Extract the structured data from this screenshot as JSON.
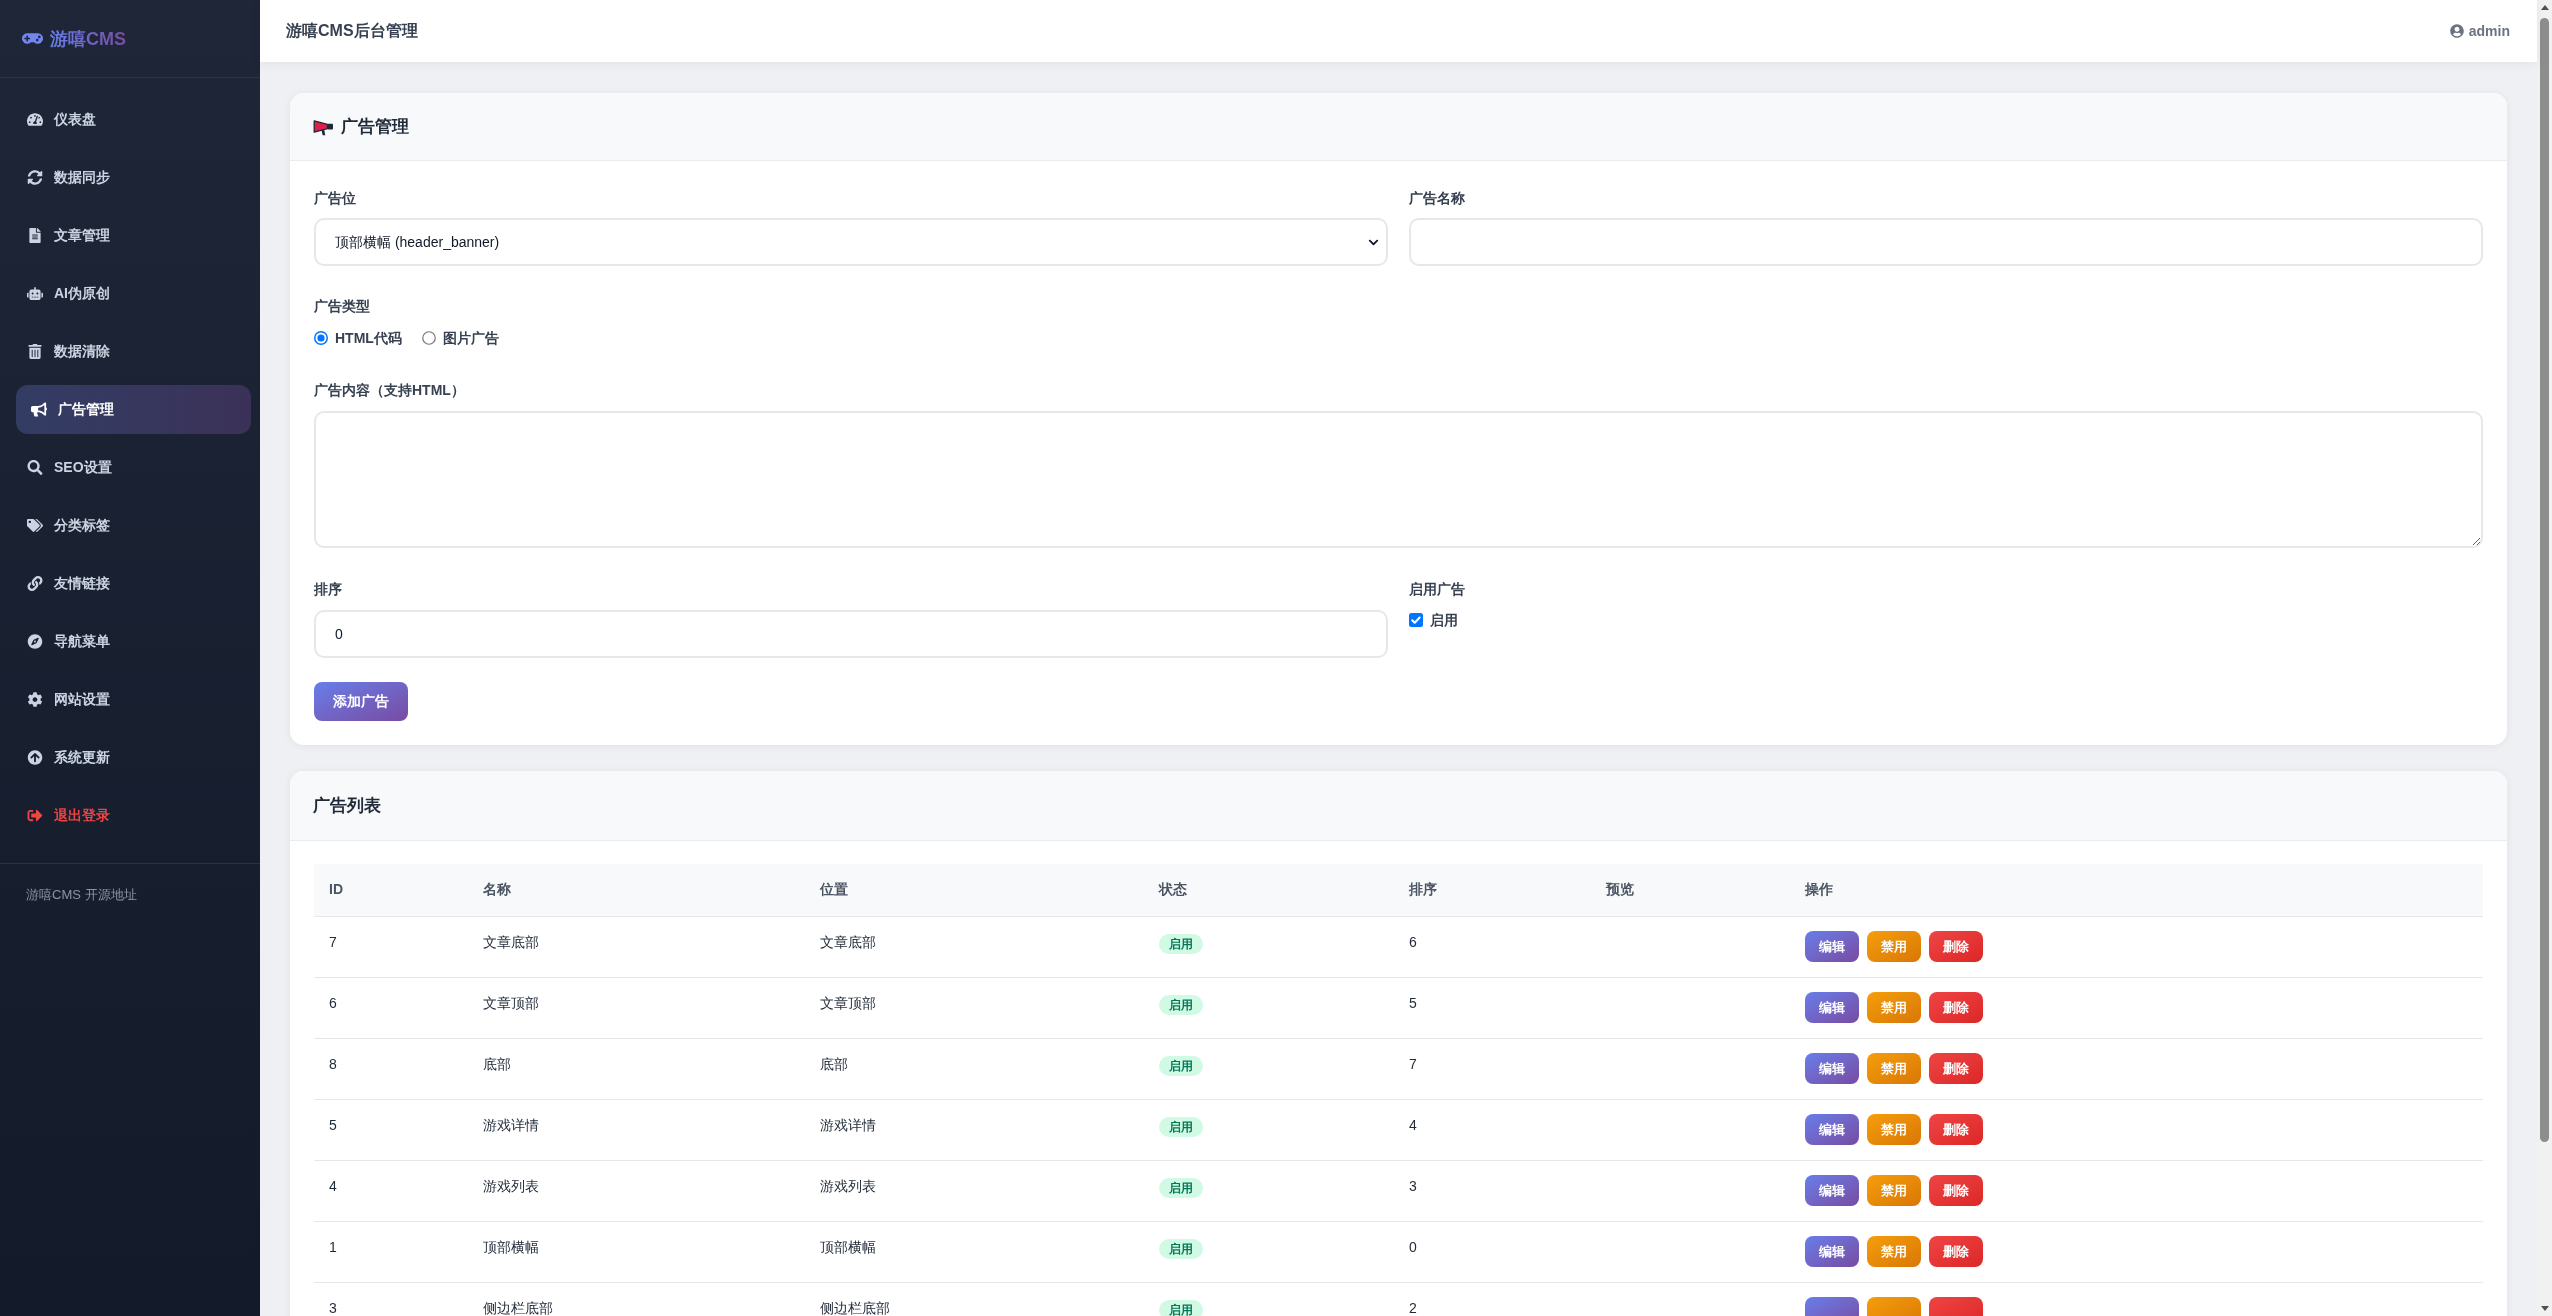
{
  "sidebar": {
    "logo": "游嘻CMS",
    "items": [
      {
        "label": "仪表盘",
        "kind": "link",
        "selected": false
      },
      {
        "label": "数据同步",
        "kind": "link",
        "selected": false
      },
      {
        "label": "文章管理",
        "kind": "link",
        "selected": false
      },
      {
        "label": "AI伪原创",
        "kind": "link",
        "selected": false
      },
      {
        "label": "数据清除",
        "kind": "link",
        "selected": false
      },
      {
        "label": "广告管理",
        "kind": "link",
        "selected": true
      },
      {
        "label": "SEO设置",
        "kind": "link",
        "selected": false
      },
      {
        "label": "分类标签",
        "kind": "link",
        "selected": false
      },
      {
        "label": "友情链接",
        "kind": "link",
        "selected": false
      },
      {
        "label": "导航菜单",
        "kind": "link",
        "selected": false
      },
      {
        "label": "网站设置",
        "kind": "link",
        "selected": false
      },
      {
        "label": "系统更新",
        "kind": "link",
        "selected": false
      },
      {
        "label": "退出登录",
        "kind": "logout",
        "selected": false
      }
    ],
    "footer_link": "游嘻CMS 开源地址"
  },
  "header": {
    "title": "游嘻CMS后台管理",
    "user": "admin"
  },
  "ad_form": {
    "title": "广告管理",
    "position": {
      "label": "广告位",
      "value": "顶部横幅 (header_banner)"
    },
    "name": {
      "label": "广告名称"
    },
    "type": {
      "label": "广告类型",
      "options": [
        {
          "label": "HTML代码",
          "selected": true
        },
        {
          "label": "图片广告",
          "selected": false
        }
      ]
    },
    "content": {
      "label": "广告内容（支持HTML）"
    },
    "sort": {
      "label": "排序",
      "value": "0"
    },
    "enabled": {
      "label": "启用广告",
      "checkbox_label": "启用",
      "checked": true
    },
    "submit": "添加广告"
  },
  "ad_list": {
    "title": "广告列表",
    "columns": [
      "ID",
      "名称",
      "位置",
      "状态",
      "排序",
      "预览",
      "操作"
    ],
    "rows": [
      {
        "id": "7",
        "name": "文章底部",
        "position": "文章底部",
        "status": "启用",
        "sort": "6",
        "actions": [
          {
            "label": "编辑",
            "kind": "edit"
          },
          {
            "label": "禁用",
            "kind": "disable"
          },
          {
            "label": "删除",
            "kind": "delete"
          }
        ]
      },
      {
        "id": "6",
        "name": "文章顶部",
        "position": "文章顶部",
        "status": "启用",
        "sort": "5",
        "actions": [
          {
            "label": "编辑",
            "kind": "edit"
          },
          {
            "label": "禁用",
            "kind": "disable"
          },
          {
            "label": "删除",
            "kind": "delete"
          }
        ]
      },
      {
        "id": "8",
        "name": "底部",
        "position": "底部",
        "status": "启用",
        "sort": "7",
        "actions": [
          {
            "label": "编辑",
            "kind": "edit"
          },
          {
            "label": "禁用",
            "kind": "disable"
          },
          {
            "label": "删除",
            "kind": "delete"
          }
        ]
      },
      {
        "id": "5",
        "name": "游戏详情",
        "position": "游戏详情",
        "status": "启用",
        "sort": "4",
        "actions": [
          {
            "label": "编辑",
            "kind": "edit"
          },
          {
            "label": "禁用",
            "kind": "disable"
          },
          {
            "label": "删除",
            "kind": "delete"
          }
        ]
      },
      {
        "id": "4",
        "name": "游戏列表",
        "position": "游戏列表",
        "status": "启用",
        "sort": "3",
        "actions": [
          {
            "label": "编辑",
            "kind": "edit"
          },
          {
            "label": "禁用",
            "kind": "disable"
          },
          {
            "label": "删除",
            "kind": "delete"
          }
        ]
      },
      {
        "id": "1",
        "name": "顶部横幅",
        "position": "顶部横幅",
        "status": "启用",
        "sort": "0",
        "actions": [
          {
            "label": "编辑",
            "kind": "edit"
          },
          {
            "label": "禁用",
            "kind": "disable"
          },
          {
            "label": "删除",
            "kind": "delete"
          }
        ]
      },
      {
        "id": "3",
        "name": "侧边栏底部",
        "position": "侧边栏底部",
        "status": "启用",
        "sort": "2",
        "actions": [
          {
            "kind": "edit"
          },
          {
            "kind": "disable"
          },
          {
            "kind": "delete"
          }
        ]
      }
    ]
  }
}
